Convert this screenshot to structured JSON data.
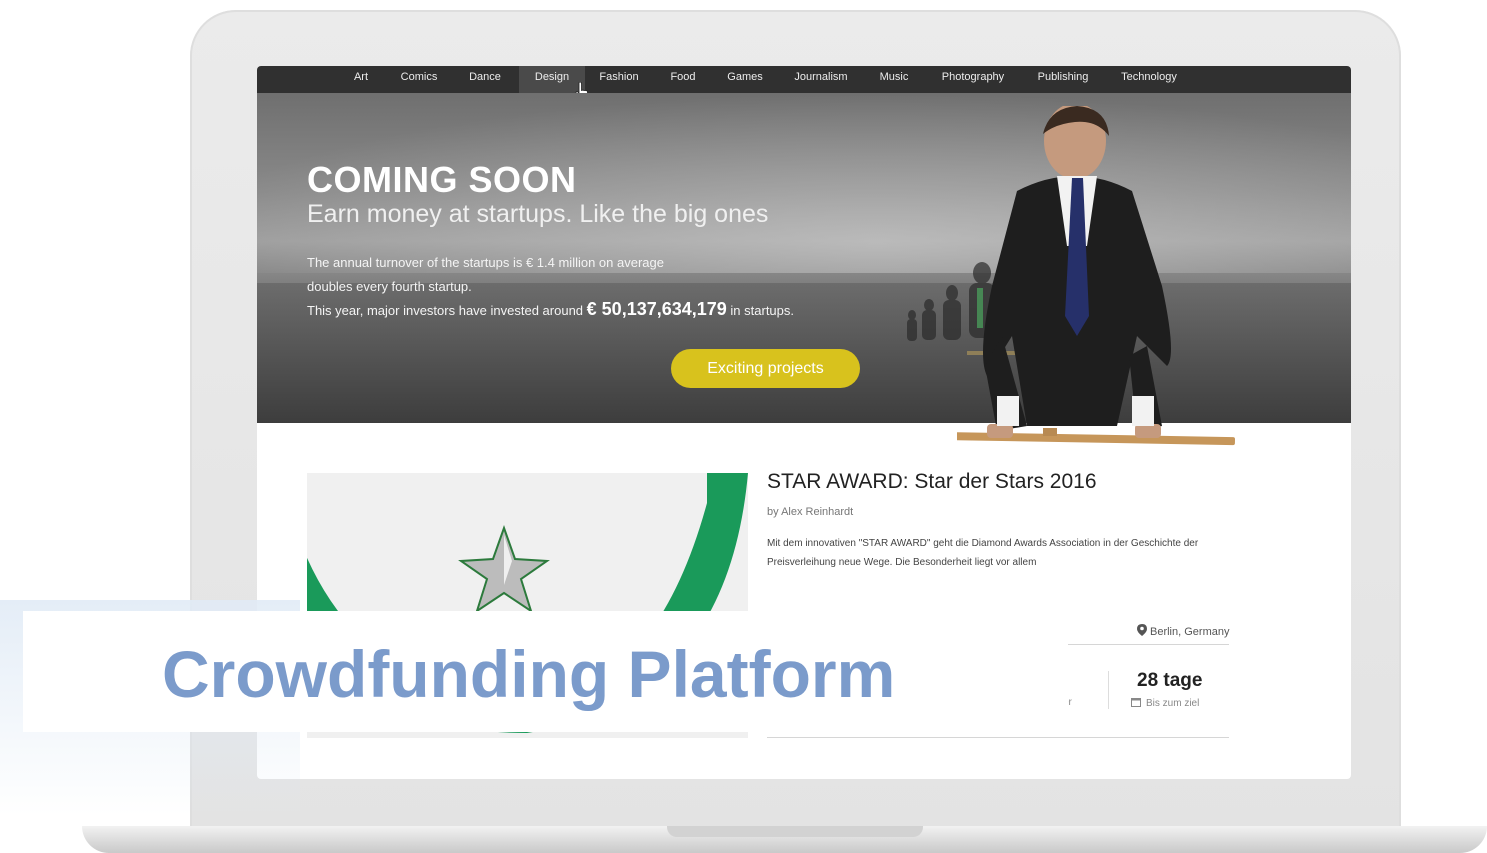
{
  "nav": {
    "items": [
      {
        "label": "Art"
      },
      {
        "label": "Comics"
      },
      {
        "label": "Dance"
      },
      {
        "label": "Design",
        "active": true
      },
      {
        "label": "Fashion"
      },
      {
        "label": "Food"
      },
      {
        "label": "Games"
      },
      {
        "label": "Journalism"
      },
      {
        "label": "Music"
      },
      {
        "label": "Photography"
      },
      {
        "label": "Publishing"
      },
      {
        "label": "Technology"
      }
    ]
  },
  "hero": {
    "title": "COMING SOON",
    "subtitle": "Earn money at startups. Like the big ones",
    "line1": "The annual turnover of the startups is € 1.4 million on average",
    "line2": "doubles every fourth startup.",
    "line3_pre": "This year, major investors have invested around",
    "line3_amount": "€ 50,137,634,179",
    "line3_post": "in startups.",
    "cta_label": "Exciting projects"
  },
  "project": {
    "title": "STAR AWARD: Star der Stars 2016",
    "author": "by Alex Reinhardt",
    "description": "Mit dem innovativen \"STAR AWARD\" geht die Diamond Awards Association in der Geschichte der Preisverleihung neue Wege. Die Besonderheit liegt vor allem",
    "location": "Berlin, Germany",
    "days_value": "28 tage",
    "days_label": "Bis zum ziel",
    "cut_label": "er"
  },
  "overlay": {
    "title": "Crowdfunding Platform"
  },
  "colors": {
    "nav_bg": "#303030",
    "cta": "#d8c21d",
    "overlay_title": "#7b9bcb",
    "award_green": "#1a9a5a"
  },
  "icons": [
    "pointer-cursor-icon",
    "location-pin-icon",
    "calendar-icon",
    "star-trophy-icon"
  ]
}
